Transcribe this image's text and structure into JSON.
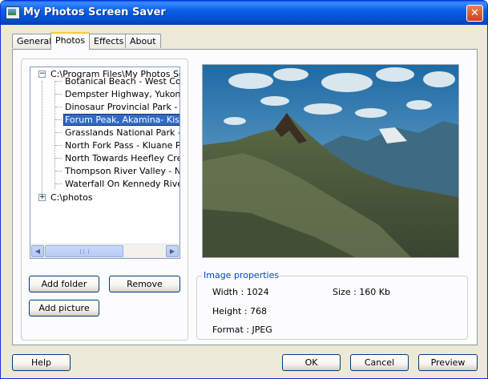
{
  "window": {
    "title": "My Photos Screen Saver",
    "close": "✕"
  },
  "tabs": [
    "General",
    "Photos",
    "Effects",
    "About"
  ],
  "tree": {
    "root1": "C:\\Program Files\\My Photos Scree",
    "items": [
      "Botanical Beach - West Coast",
      "Dempster Highway, Yukon.jpg",
      "Dinosaur Provincial Park - Bac",
      "Forum Peak, Akamina- Kishine",
      "Grasslands National Park - Sa",
      "North Fork Pass - Kluane Park",
      "North Towards Heefley Creek,",
      "Thompson River Valley - Near",
      "Waterfall On Kennedy River - \\"
    ],
    "selected_index": 3,
    "root2": "C:\\photos",
    "expand_minus": "−",
    "expand_plus": "+",
    "scroll_left": "◀",
    "scroll_right": "▶"
  },
  "buttons": {
    "add_folder": "Add folder",
    "remove": "Remove",
    "add_picture": "Add picture",
    "help": "Help",
    "ok": "OK",
    "cancel": "Cancel",
    "preview": "Preview"
  },
  "props": {
    "title": "Image properties",
    "width": "Width : 1024",
    "height": "Height : 768",
    "format": "Format : JPEG",
    "size": "Size : 160 Kb"
  },
  "colors": {
    "selection": "#316ac5",
    "titlebar": "#0453d8",
    "group_title": "#0046d5"
  }
}
